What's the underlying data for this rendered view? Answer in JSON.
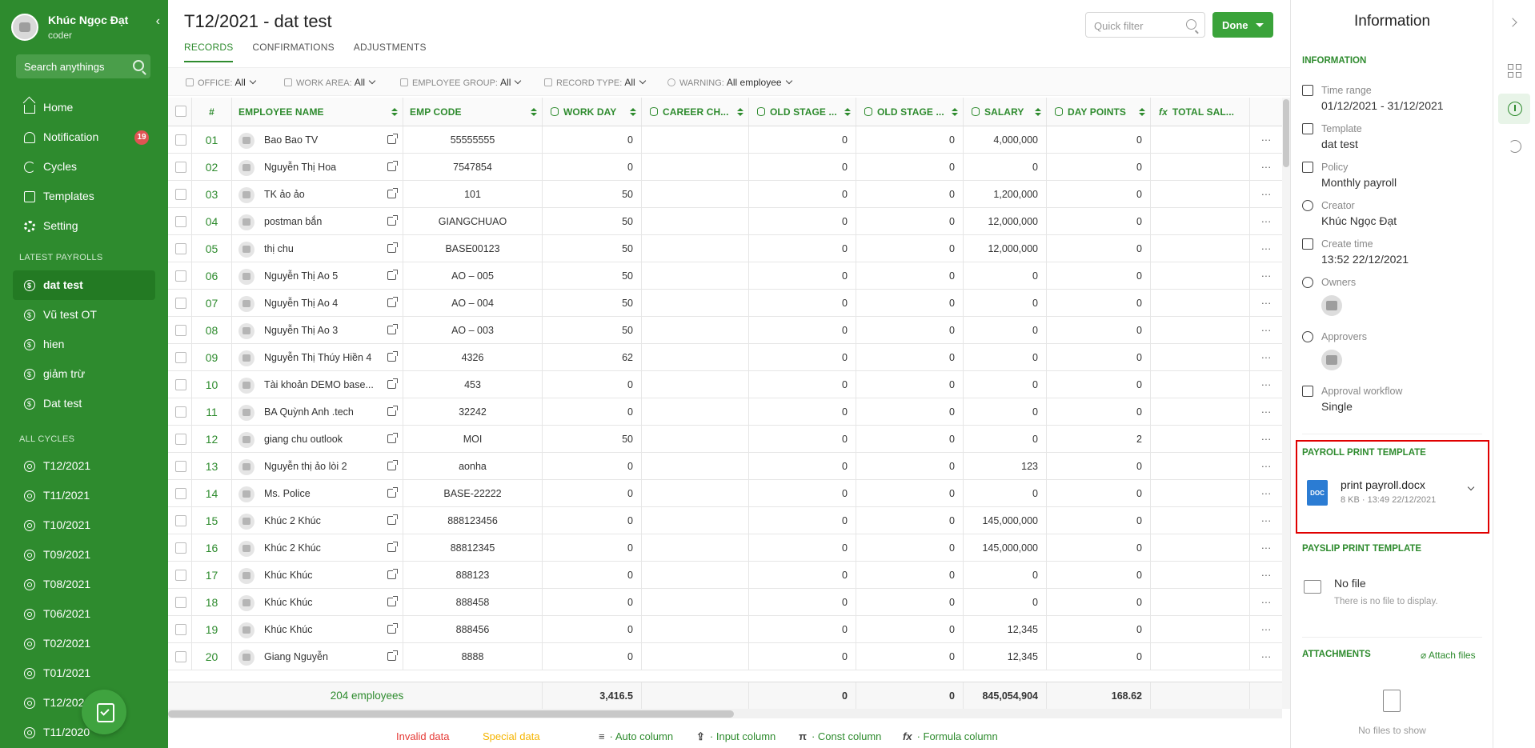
{
  "sidebar": {
    "user_name": "Khúc Ngọc Đạt",
    "user_role": "coder",
    "collapse_icon": "‹",
    "search_placeholder": "Search anythings",
    "menu": [
      {
        "label": "Home",
        "icon": "home-icon"
      },
      {
        "label": "Notification",
        "icon": "bell-icon",
        "badge": "19"
      },
      {
        "label": "Cycles",
        "icon": "cycle-icon"
      },
      {
        "label": "Templates",
        "icon": "template-icon"
      },
      {
        "label": "Setting",
        "icon": "gear-icon"
      }
    ],
    "latest_title": "LATEST PAYROLLS",
    "latest": [
      "dat test",
      "Vũ test OT",
      "hien",
      "giảm trừ",
      "Dat test"
    ],
    "cycles_title": "ALL CYCLES",
    "cycles": [
      "T12/2021",
      "T11/2021",
      "T10/2021",
      "T09/2021",
      "T08/2021",
      "T06/2021",
      "T02/2021",
      "T01/2021",
      "T12/2020",
      "T11/2020"
    ]
  },
  "header": {
    "title": "T12/2021 - dat test",
    "tabs": [
      "RECORDS",
      "CONFIRMATIONS",
      "ADJUSTMENTS"
    ],
    "quick_filter_placeholder": "Quick filter",
    "done_label": "Done"
  },
  "filters": [
    {
      "label": "OFFICE:",
      "value": "All"
    },
    {
      "label": "WORK AREA:",
      "value": "All"
    },
    {
      "label": "EMPLOYEE GROUP:",
      "value": "All"
    },
    {
      "label": "RECORD TYPE:",
      "value": "All"
    },
    {
      "label": "WARNING:",
      "value": "All employee"
    }
  ],
  "table": {
    "columns": {
      "num": "#",
      "name": "EMPLOYEE NAME",
      "code": "EMP CODE",
      "work_day": "WORK DAY",
      "career": "CAREER CH...",
      "old_stage_1": "OLD STAGE ...",
      "old_stage_2": "OLD STAGE ...",
      "salary": "SALARY",
      "day_points": "DAY POINTS",
      "total_sal": "TOTAL SAL..."
    },
    "rows": [
      [
        "01",
        "Bao Bao TV",
        "55555555",
        "0",
        "",
        "0",
        "0",
        "4,000,000",
        "0"
      ],
      [
        "02",
        "Nguyễn Thị Hoa",
        "7547854",
        "0",
        "",
        "0",
        "0",
        "0",
        "0"
      ],
      [
        "03",
        "TK ảo ảo",
        "101",
        "50",
        "",
        "0",
        "0",
        "1,200,000",
        "0"
      ],
      [
        "04",
        "postman bắn",
        "GIANGCHUAO",
        "50",
        "",
        "0",
        "0",
        "12,000,000",
        "0"
      ],
      [
        "05",
        "thị chu",
        "BASE00123",
        "50",
        "",
        "0",
        "0",
        "12,000,000",
        "0"
      ],
      [
        "06",
        "Nguyễn Thị Ao 5",
        "AO – 005",
        "50",
        "",
        "0",
        "0",
        "0",
        "0"
      ],
      [
        "07",
        "Nguyễn Thị Ao 4",
        "AO – 004",
        "50",
        "",
        "0",
        "0",
        "0",
        "0"
      ],
      [
        "08",
        "Nguyễn Thị Ao 3",
        "AO – 003",
        "50",
        "",
        "0",
        "0",
        "0",
        "0"
      ],
      [
        "09",
        "Nguyễn Thị Thúy Hiền 4",
        "4326",
        "62",
        "",
        "0",
        "0",
        "0",
        "0"
      ],
      [
        "10",
        "Tài khoản DEMO base...",
        "453",
        "0",
        "",
        "0",
        "0",
        "0",
        "0"
      ],
      [
        "11",
        "BA Quỳnh Anh .tech",
        "32242",
        "0",
        "",
        "0",
        "0",
        "0",
        "0"
      ],
      [
        "12",
        "giang chu outlook",
        "MOI",
        "50",
        "",
        "0",
        "0",
        "0",
        "2"
      ],
      [
        "13",
        "Nguyễn thị ảo lòi 2",
        "aonha",
        "0",
        "",
        "0",
        "0",
        "123",
        "0"
      ],
      [
        "14",
        "Ms. Police",
        "BASE-22222",
        "0",
        "",
        "0",
        "0",
        "0",
        "0"
      ],
      [
        "15",
        "Khúc 2 Khúc",
        "888123456",
        "0",
        "",
        "0",
        "0",
        "145,000,000",
        "0"
      ],
      [
        "16",
        "Khúc 2 Khúc",
        "88812345",
        "0",
        "",
        "0",
        "0",
        "145,000,000",
        "0"
      ],
      [
        "17",
        "Khúc Khúc",
        "888123",
        "0",
        "",
        "0",
        "0",
        "0",
        "0"
      ],
      [
        "18",
        "Khúc Khúc",
        "888458",
        "0",
        "",
        "0",
        "0",
        "0",
        "0"
      ],
      [
        "19",
        "Khúc Khúc",
        "888456",
        "0",
        "",
        "0",
        "0",
        "12,345",
        "0"
      ],
      [
        "20",
        "Giang Nguyễn",
        "8888",
        "0",
        "",
        "0",
        "0",
        "12,345",
        "0"
      ]
    ],
    "row_action": "···",
    "footer": {
      "employees": "204 employees",
      "work_day": "3,416.5",
      "old_stage_1": "0",
      "old_stage_2": "0",
      "salary": "845,054,904",
      "day_points": "168.62"
    }
  },
  "legend": [
    {
      "label": "Invalid data",
      "color": "#e53935"
    },
    {
      "label": "Special data",
      "color": "#f5b400"
    },
    {
      "label": "· Auto column",
      "icon": "database-icon",
      "color": "#2e8b2e"
    },
    {
      "label": "· Input column",
      "icon": "upload-icon",
      "color": "#2e8b2e"
    },
    {
      "label": "· Const column",
      "icon": "pi-icon",
      "color": "#2e8b2e"
    },
    {
      "label": "· Formula column",
      "icon": "function-icon",
      "color": "#2e8b2e"
    }
  ],
  "info": {
    "title": "Information",
    "section_information": "INFORMATION",
    "time_range_label": "Time range",
    "time_range_value": "01/12/2021 - 31/12/2021",
    "template_label": "Template",
    "template_value": "dat test",
    "policy_label": "Policy",
    "policy_value": "Monthly payroll",
    "creator_label": "Creator",
    "creator_value": "Khúc Ngọc Đạt",
    "create_time_label": "Create time",
    "create_time_value": "13:52 22/12/2021",
    "owners_label": "Owners",
    "approvers_label": "Approvers",
    "workflow_label": "Approval workflow",
    "workflow_value": "Single",
    "payroll_print_title": "PAYROLL PRINT TEMPLATE",
    "payroll_file_badge": "DOC",
    "payroll_file_name": "print payroll.docx",
    "payroll_file_meta": "8 KB · 13:49 22/12/2021",
    "payslip_print_title": "PAYSLIP PRINT TEMPLATE",
    "payslip_no_file": "No file",
    "payslip_no_file_sub": "There is no file to display.",
    "attachments_title": "ATTACHMENTS",
    "attach_link": "Attach files",
    "no_files": "No files to show"
  },
  "colors": {
    "brand": "#2e8b2e",
    "highlight_border": "#e00000"
  }
}
